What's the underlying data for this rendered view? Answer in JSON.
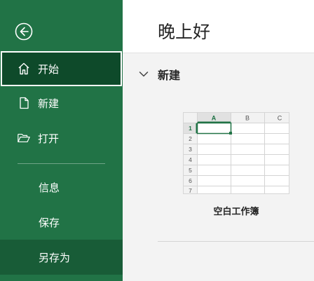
{
  "greeting": "晚上好",
  "sidebar": {
    "back_icon": "back-arrow-icon",
    "items": [
      {
        "label": "开始",
        "icon": "home-icon",
        "active": true
      },
      {
        "label": "新建",
        "icon": "new-file-icon"
      },
      {
        "label": "打开",
        "icon": "open-folder-icon"
      },
      {
        "label": "信息"
      },
      {
        "label": "保存"
      },
      {
        "label": "另存为",
        "hover": true
      }
    ]
  },
  "new_section": {
    "title": "新建",
    "templates": [
      {
        "label": "空白工作簿",
        "column_headers": [
          "A",
          "B",
          "C"
        ],
        "row_numbers": [
          "1",
          "2",
          "3",
          "4",
          "5",
          "6",
          "7"
        ]
      }
    ]
  },
  "colors": {
    "sidebar_bg": "#217346",
    "active_bg": "#0e4a2a",
    "hover_bg": "#185c37",
    "accent": "#217346"
  }
}
